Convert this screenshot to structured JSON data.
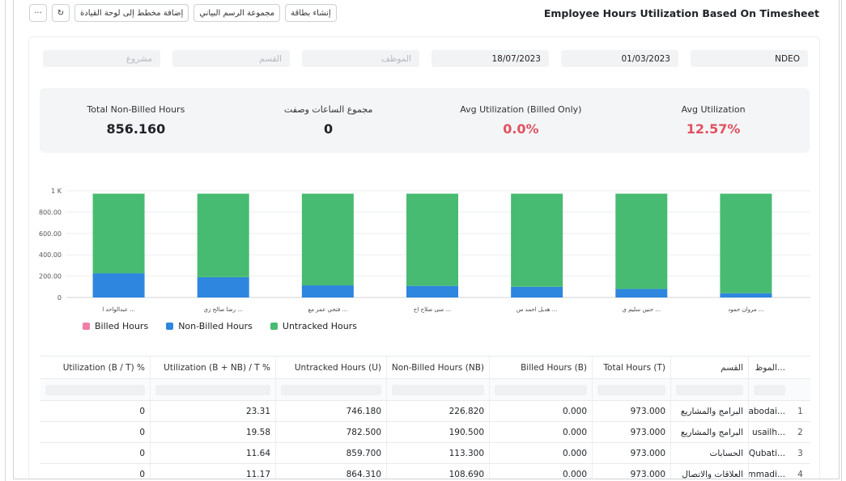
{
  "toolbar": {
    "more_label": "···",
    "refresh_label": "↻",
    "add_to_dashboard": "إضافة مخطط إلى لوحة القيادة",
    "chart_group": "مجموعة الرسم البياني",
    "create_card": "إنشاء بطاقة"
  },
  "page_title": "Employee Hours Utilization Based On Timesheet",
  "filters": [
    {
      "value": "NDEO",
      "placeholder": false
    },
    {
      "value": "01/03/2023",
      "placeholder": false
    },
    {
      "value": "18/07/2023",
      "placeholder": false
    },
    {
      "value": "الموظف",
      "placeholder": true
    },
    {
      "value": "القسم",
      "placeholder": true
    },
    {
      "value": "مشروع",
      "placeholder": true
    }
  ],
  "stats": [
    {
      "label": "Avg Utilization",
      "value": "12.57%",
      "color": "#e05260"
    },
    {
      "label": "Avg Utilization (Billed Only)",
      "value": "0.0%",
      "color": "#e05260"
    },
    {
      "label": "مجموع الساعات وصفت",
      "value": "0",
      "color": "#1f2328"
    },
    {
      "label": "Total Non-Billed Hours",
      "value": "856.160",
      "color": "#1f2328"
    }
  ],
  "chart_data": {
    "type": "bar",
    "stacked": true,
    "categories": [
      "عبدالواحد ا ...",
      "رضا صالح زي ...",
      "فتحي عمر مع ...",
      "منى صلاح اح ...",
      "هديل احمد س ...",
      "حنين سليم ي ...",
      "مروان حمود ..."
    ],
    "series": [
      {
        "name": "Billed Hours",
        "color": "#f07fa8",
        "values": [
          0,
          0,
          0,
          0,
          0,
          0,
          0
        ]
      },
      {
        "name": "Non-Billed Hours",
        "color": "#2e86de",
        "values": [
          226.82,
          190.5,
          113.3,
          108.69,
          100,
          80,
          40
        ]
      },
      {
        "name": "Untracked Hours",
        "color": "#48bb72",
        "values": [
          746.18,
          782.5,
          859.7,
          864.31,
          873,
          893,
          933
        ]
      }
    ],
    "yticks": [
      "0",
      "200.00",
      "400.00",
      "600.00",
      "800.00",
      "1 K"
    ],
    "ylim": [
      0,
      1000
    ],
    "grid": true,
    "legend": "bottom-left"
  },
  "table": {
    "headers": [
      "الموظ...",
      "القسم",
      "Total Hours (T)",
      "Billed Hours (B)",
      "Non-Billed Hours (NB)",
      "Untracked Hours (U)",
      "Utilization (B + NB) / T %",
      "Utilization (B / T) %"
    ],
    "rows": [
      [
        "1",
        "abodai...",
        "البرامج والمشاريع",
        "973.000",
        "0.000",
        "226.820",
        "746.180",
        "23.31",
        "0"
      ],
      [
        "2",
        "usailh...",
        "البرامج والمشاريع",
        "973.000",
        "0.000",
        "190.500",
        "782.500",
        "19.58",
        "0"
      ],
      [
        "3",
        "lQubati...",
        "الحسابات",
        "973.000",
        "0.000",
        "113.300",
        "859.700",
        "11.64",
        "0"
      ],
      [
        "4",
        "mmadi...",
        "العلاقات والاتصال",
        "973.000",
        "0.000",
        "108.690",
        "864.310",
        "11.17",
        "0"
      ]
    ]
  }
}
